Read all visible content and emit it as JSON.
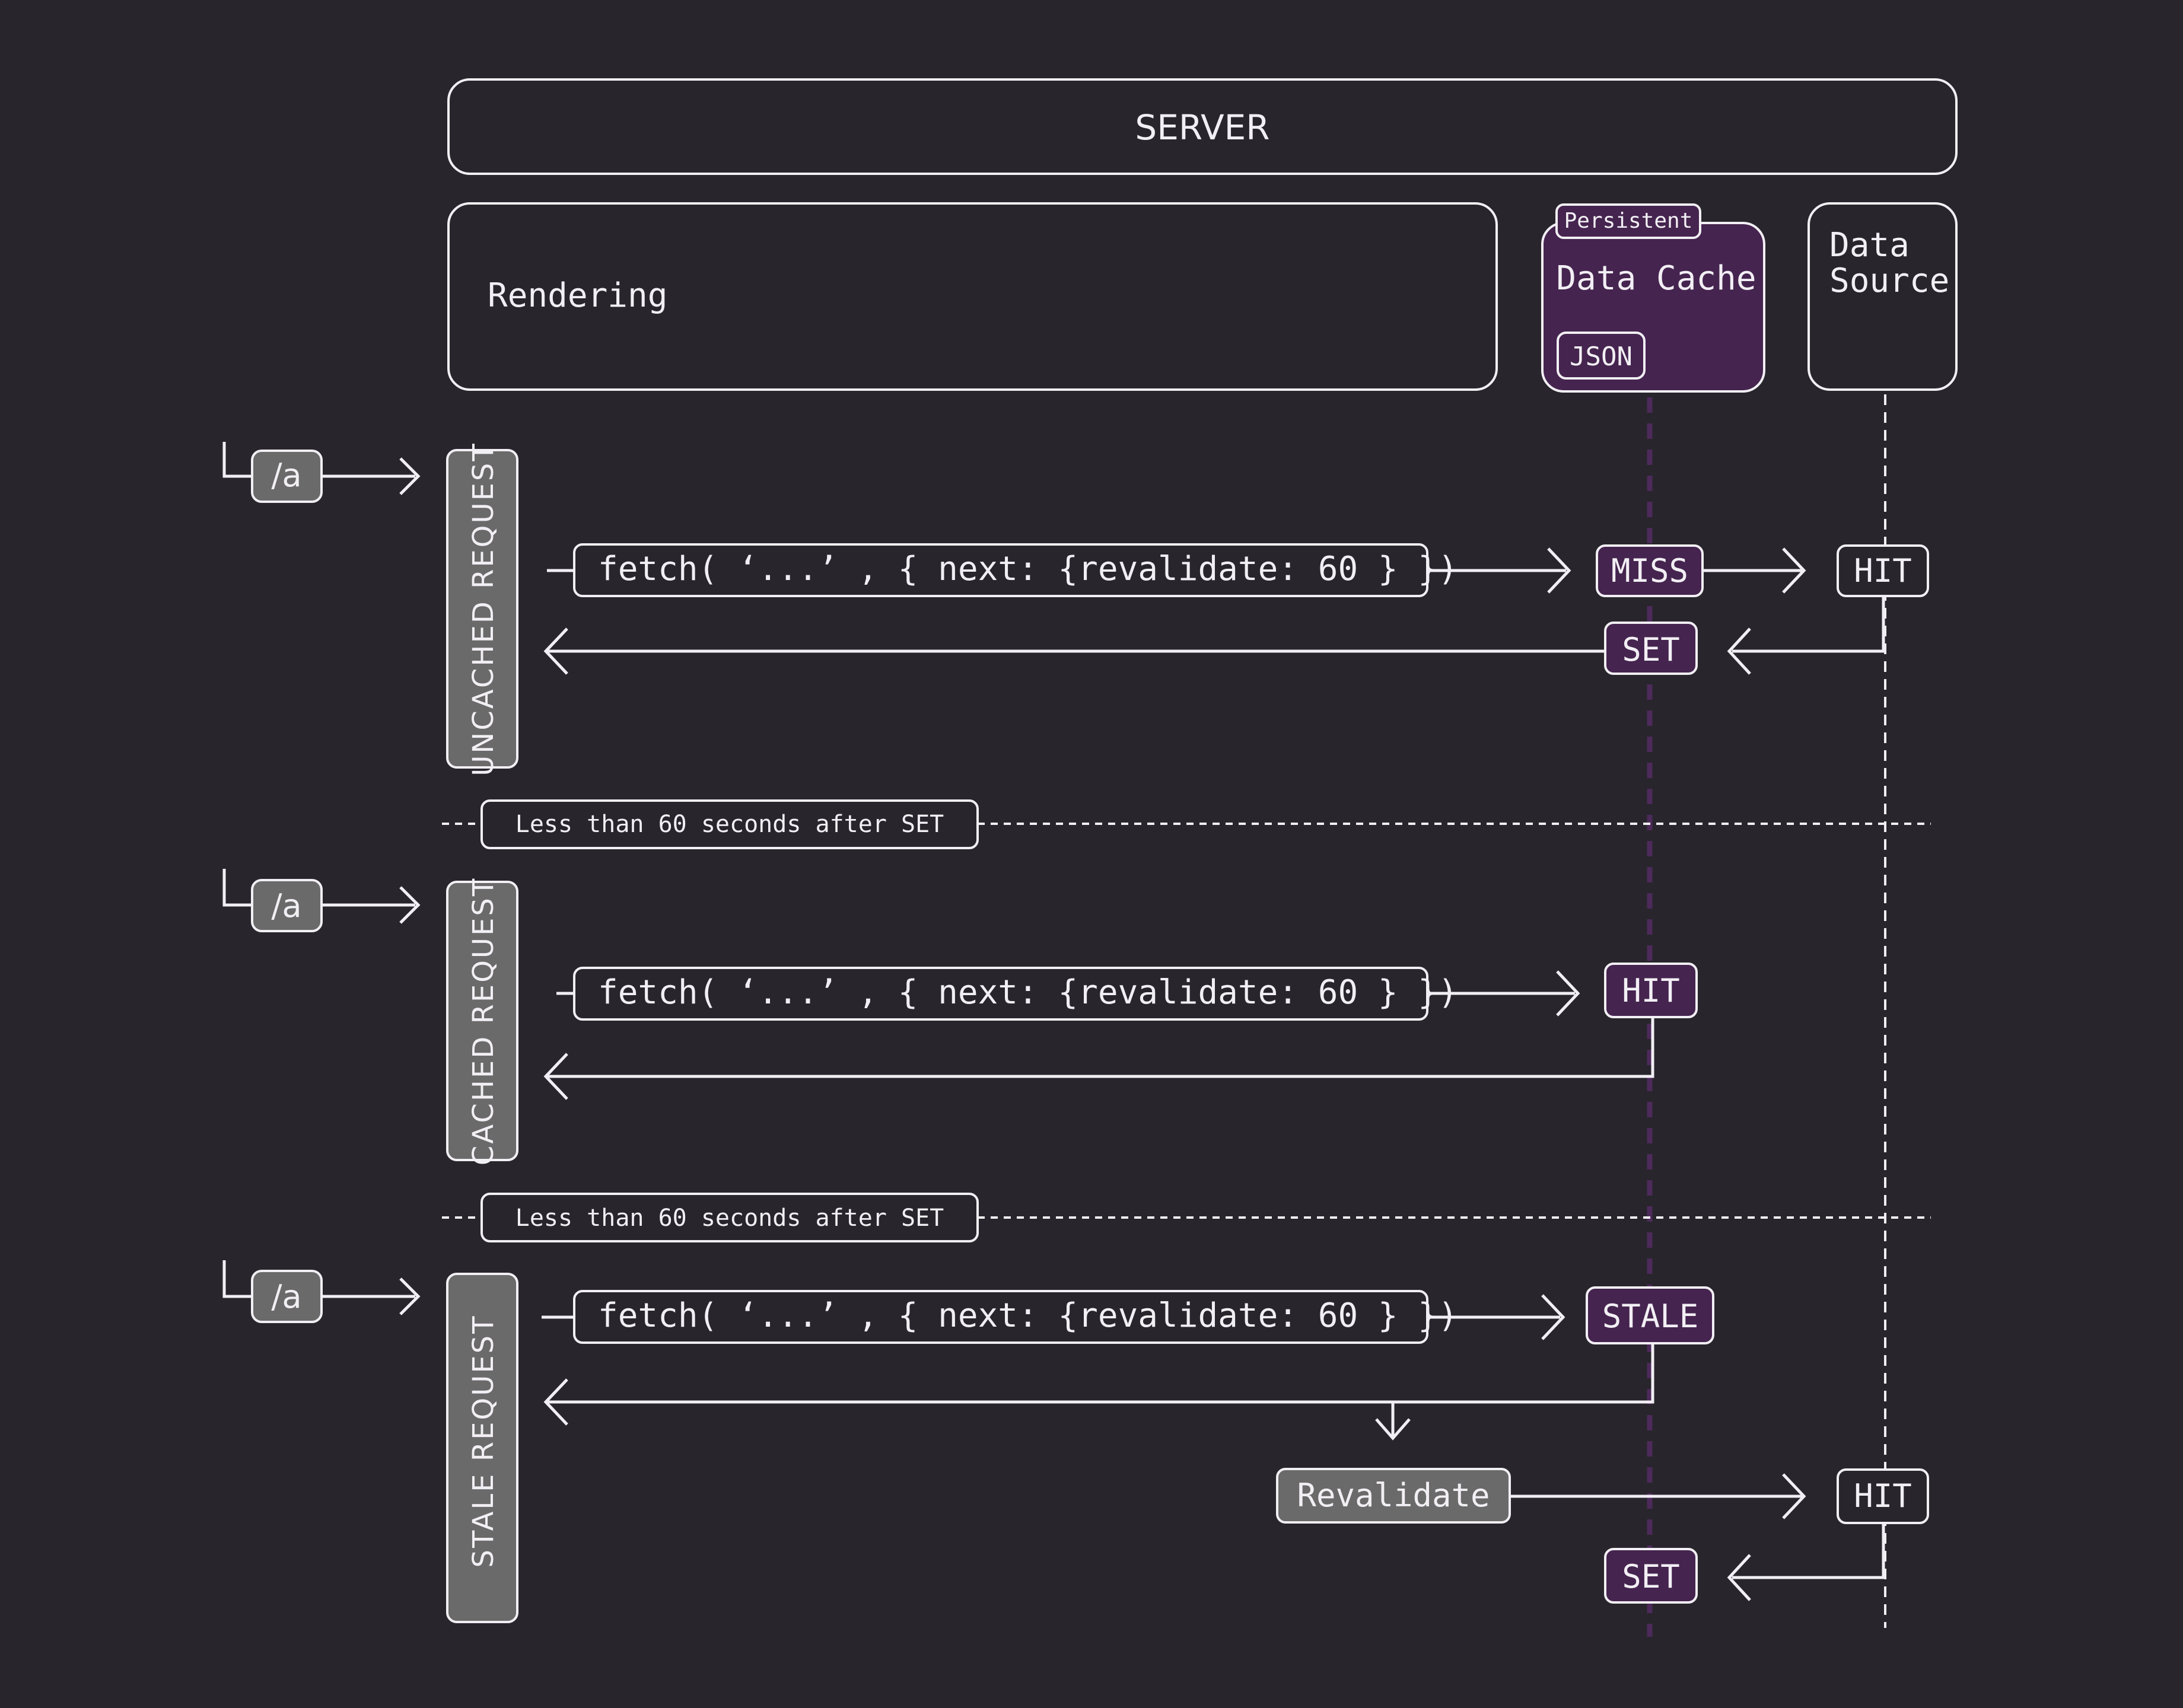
{
  "colors": {
    "background": "#28252c",
    "line": "#f2eff4",
    "cache_purple": "#45244f",
    "request_gray": "#6a6a6a"
  },
  "header": {
    "server_label": "SERVER"
  },
  "columns": {
    "rendering_label": "Rendering",
    "data_cache": {
      "tag": "Persistent",
      "label": "Data Cache",
      "format_badge": "JSON"
    },
    "data_source": {
      "line1": "Data",
      "line2": "Source"
    }
  },
  "sections": [
    {
      "route": "/a",
      "request_label": "UNCACHED REQUEST",
      "fetch_code": "fetch( ‘...’ , { next: {revalidate: 60 } })",
      "cache_status": "MISS",
      "source_status": "HIT",
      "cache_set": "SET"
    },
    {
      "divider": "Less than 60 seconds after SET",
      "route": "/a",
      "request_label": "CACHED REQUEST",
      "fetch_code": "fetch( ‘...’ , { next: {revalidate: 60 } })",
      "cache_status": "HIT"
    },
    {
      "divider": "Less than 60 seconds after SET",
      "route": "/a",
      "request_label": "STALE REQUEST",
      "fetch_code": "fetch( ‘...’ , { next: {revalidate: 60 } })",
      "cache_status": "STALE",
      "revalidate_label": "Revalidate",
      "source_status": "HIT",
      "cache_set": "SET"
    }
  ],
  "icons": {
    "arrow_right": "arrow-right-icon",
    "arrow_left": "arrow-left-icon",
    "arrow_down": "arrow-down-icon"
  }
}
